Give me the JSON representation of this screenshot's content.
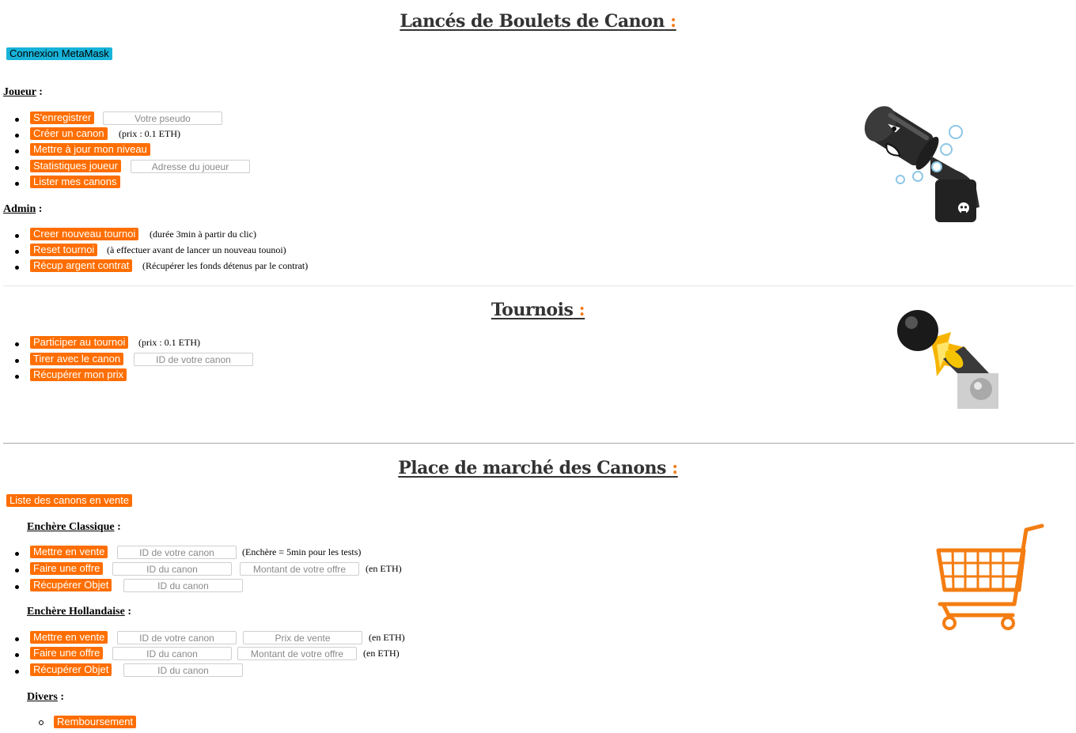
{
  "sections": {
    "main_title": "Lancés de Boulets de Canon",
    "tournament_title": "Tournois",
    "market_title": "Place de marché des Canons",
    "title_colon": ":"
  },
  "connect_button": "Connexion MetaMask",
  "player": {
    "heading": "Joueur",
    "register_button": "S'enregistrer",
    "pseudo_placeholder": "Votre pseudo",
    "create_canon_button": "Créer un canon",
    "create_canon_note": "(prix : 0.1 ETH)",
    "update_level_button": "Mettre à jour mon niveau",
    "stats_button": "Statistiques joueur",
    "player_address_placeholder": "Adresse du joueur",
    "list_canons_button": "Lister mes canons"
  },
  "admin": {
    "heading": "Admin",
    "new_tournament_button": "Creer nouveau tournoi",
    "new_tournament_note": "(durée 3min à partir du clic)",
    "reset_tournament_button": "Reset tournoi",
    "reset_tournament_note": "(à effectuer avant de lancer un nouveau tounoi)",
    "withdraw_button": "Récup argent contrat",
    "withdraw_note": "(Récupérer les fonds détenus par le contrat)"
  },
  "tournament": {
    "join_button": "Participer au tournoi",
    "join_note": "(prix : 0.1 ETH)",
    "fire_button": "Tirer avec le canon",
    "canon_id_placeholder": "ID de votre canon",
    "claim_prize_button": "Récupérer mon prix"
  },
  "market": {
    "list_on_sale_button": "Liste des canons en vente",
    "classic": {
      "heading": "Enchère Classique",
      "sell_button": "Mettre en vente",
      "sell_placeholder": "ID de votre canon",
      "sell_note": "(Enchère = 5min pour les tests)",
      "bid_button": "Faire une offre",
      "bid_id_placeholder": "ID du canon",
      "bid_amount_placeholder": "Montant de votre offre",
      "bid_note": "(en ETH)",
      "claim_button": "Récupérer Objet",
      "claim_placeholder": "ID du canon"
    },
    "dutch": {
      "heading": "Enchère Hollandaise",
      "sell_button": "Mettre en vente",
      "sell_placeholder": "ID de votre canon",
      "price_placeholder": "Prix de vente",
      "sell_note": "(en ETH)",
      "bid_button": "Faire une offre",
      "bid_id_placeholder": "ID du canon",
      "bid_amount_placeholder": "Montant de votre offre",
      "bid_note": "(en ETH)",
      "claim_button": "Récupérer Objet",
      "claim_placeholder": "ID du canon"
    },
    "misc": {
      "heading": "Divers",
      "refund_button": "Remboursement"
    }
  },
  "colors": {
    "button_orange": "#ff6e00",
    "button_blue": "#17b3d9",
    "title_gray": "#333333",
    "colon_orange": "#f07f1c"
  },
  "icons": {
    "bullet_bill_cannon": "bullet-bill-cannon-icon",
    "cannon_firing": "cannon-firing-icon",
    "shopping_cart": "shopping-cart-icon"
  }
}
